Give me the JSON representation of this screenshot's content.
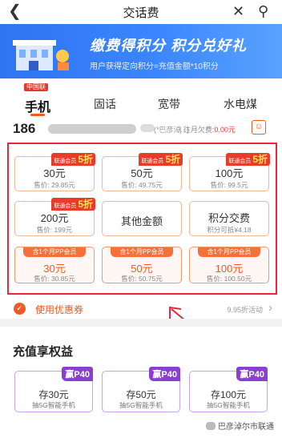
{
  "header": {
    "title": "交话费",
    "back_icon": "chevron-left-icon",
    "close_icon": "close-icon",
    "search_icon": "search-icon"
  },
  "banner": {
    "main": "缴费得积分  积分兑好礼",
    "sub": "用户获得定向积分=充值金额*10积分"
  },
  "tabs": [
    {
      "label": "手机",
      "active": true,
      "logo": "中国联通"
    },
    {
      "label": "固话"
    },
    {
      "label": "宽带"
    },
    {
      "label": "水电煤"
    }
  ],
  "account": {
    "phone_prefix": "186",
    "owner": "(*巴彦淖...)",
    "arrears_label": "| 往月欠费:",
    "arrears_value": "0.00元"
  },
  "recharge_options": [
    {
      "amount": "30元",
      "price": "售价: 29.85元",
      "badge": "联通会员",
      "badge_discount": "5折"
    },
    {
      "amount": "50元",
      "price": "售价: 49.75元",
      "badge": "联通会员",
      "badge_discount": "5折"
    },
    {
      "amount": "100元",
      "price": "售价: 99.5元",
      "badge": "联通会员",
      "badge_discount": "5折"
    },
    {
      "amount": "200元",
      "price": "售价: 199元",
      "badge": "联通会员",
      "badge_discount": "5折"
    },
    {
      "label": "其他金额"
    },
    {
      "label": "积分交费",
      "price": "积分可抵¥4.18"
    }
  ],
  "pp_options": [
    {
      "tag": "含1个月PP会员",
      "amount": "30元",
      "price": "售价: 30.85元"
    },
    {
      "tag": "含1个月PP会员",
      "amount": "50元",
      "price": "售价: 50.75元"
    },
    {
      "tag": "含1个月PP会员",
      "amount": "100元",
      "price": "售价: 100.50元"
    }
  ],
  "coupon": {
    "label": "使用优惠券",
    "right_text": "9.95折活动"
  },
  "benefits": {
    "title": "充值享权益",
    "items": [
      {
        "tag": "赢P40",
        "main": "存30元",
        "sub": "抽5G智能手机"
      },
      {
        "tag": "赢P40",
        "main": "存50元",
        "sub": "抽5G智能手机"
      },
      {
        "tag": "赢P40",
        "main": "存100元",
        "sub": "抽5G智能手机"
      }
    ]
  },
  "watermark": "巴彦淖尔市联通",
  "colors": {
    "accent": "#f05a23",
    "highlight": "#e8283a",
    "banner": "#3a86ff",
    "purple": "#8a3fd1"
  }
}
